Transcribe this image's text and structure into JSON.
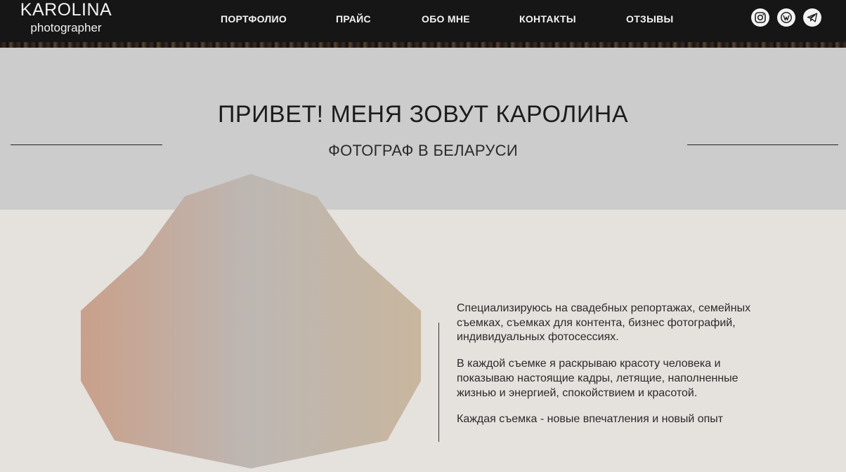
{
  "logo": {
    "name": "KAROLINA",
    "subtitle": "photographer"
  },
  "nav": [
    "ПОРТФОЛИО",
    "ПРАЙС",
    "ОБО МНЕ",
    "КОНТАКТЫ",
    "ОТЗЫВЫ"
  ],
  "social": [
    {
      "icon": "instagram-icon"
    },
    {
      "icon": "vk-icon"
    },
    {
      "icon": "telegram-icon"
    }
  ],
  "hero": {
    "title": "ПРИВЕТ! МЕНЯ ЗОВУТ КАРОЛИНА",
    "subtitle": "ФОТОГРАФ В БЕЛАРУСИ"
  },
  "bio": [
    "Специализируюсь на свадебных репортажах, семейных съемках, съемках для контента, бизнес фотографий, индивидуальных фотосессиях.",
    "В каждой съемке я раскрываю красоту человека и показываю настоящие кадры, летящие, наполненные жизнью и энергией, спокойствием и красотой.",
    "Каждая съемка - новые впечатления и новый опыт"
  ],
  "colors": {
    "header_bg": "#161616",
    "hero_bg": "#cccccc",
    "page_bg": "#e5e1dd",
    "text": "#2b2b2b"
  }
}
